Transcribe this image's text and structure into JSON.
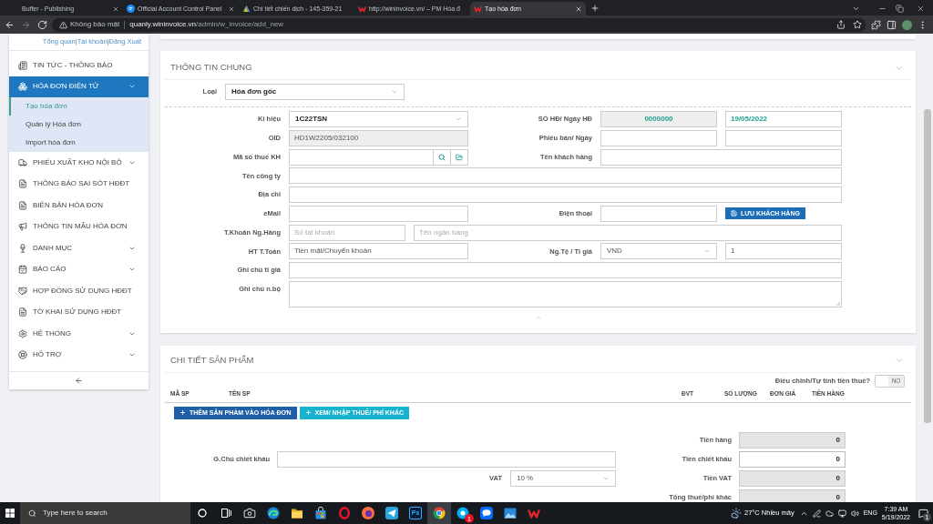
{
  "browser": {
    "tabs": [
      {
        "title": "Buffer - Publishing",
        "selected": false,
        "close_button": true
      },
      {
        "title": "Official Account Control Panel",
        "selected": false,
        "close_button": true
      },
      {
        "title": "Chi tiết chiến dịch - 145-359-21",
        "selected": false,
        "close_button": false
      },
      {
        "title": "http://wininvoice.vn/ – PM Hóa đ",
        "selected": false,
        "close_button": false
      },
      {
        "title": "Tạo hóa đơn",
        "selected": true,
        "close_button": true
      }
    ],
    "address_bar": {
      "security_label": "Không bảo mật",
      "host": "quanly.wininvoice.vn",
      "path": "/admin/w_invoice/add_new"
    }
  },
  "sidebar": {
    "account_links": [
      {
        "kind": "link",
        "text": "Tổng quan"
      },
      {
        "kind": "separator",
        "text": "|"
      },
      {
        "kind": "link",
        "text": "Tài khoản"
      },
      {
        "kind": "separator",
        "text": "|"
      },
      {
        "kind": "link",
        "text": "Đăng Xuất"
      }
    ],
    "items": [
      {
        "label": "TIN TỨC - THÔNG BÁO",
        "selected": false,
        "submenu": false
      },
      {
        "label": "HÓA ĐƠN ĐIỆN TỬ",
        "selected": true,
        "submenu": true,
        "children": [
          {
            "label": "Tạo hóa đơn",
            "selected": true
          },
          {
            "label": "Quản lý Hóa đơn",
            "selected": false
          },
          {
            "label": "Import hóa đơn",
            "selected": false
          }
        ]
      },
      {
        "label": "PHIẾU XUẤT KHO NỘI BỘ",
        "selected": false,
        "submenu": true
      },
      {
        "label": "THÔNG BÁO SAI SÓT HĐĐT",
        "selected": false,
        "submenu": false
      },
      {
        "label": "BIÊN BẢN HÓA ĐƠN",
        "selected": false,
        "submenu": false
      },
      {
        "label": "THÔNG TIN MẪU HÓA ĐƠN",
        "selected": false,
        "submenu": false
      },
      {
        "label": "DANH MỤC",
        "selected": false,
        "submenu": true
      },
      {
        "label": "BÁO CÁO",
        "selected": false,
        "submenu": true
      },
      {
        "label": "HỢP ĐỒNG SỬ DỤNG HĐĐT",
        "selected": false,
        "submenu": false
      },
      {
        "label": "TỜ KHAI SỬ DỤNG HĐĐT",
        "selected": false,
        "submenu": false
      },
      {
        "label": "HỆ THỐNG",
        "selected": false,
        "submenu": true
      },
      {
        "label": "HỖ TRỢ",
        "selected": false,
        "submenu": true
      }
    ]
  },
  "general_info": {
    "title": "THÔNG TIN CHUNG",
    "invoice_type": {
      "label": "Loại",
      "value": "Hóa đơn gốc",
      "bold": true
    },
    "rows": [
      {
        "label": "Kí hiệu",
        "left": [
          {
            "kind": "select",
            "value": "1C22TSN",
            "bold": true
          }
        ],
        "right_label": "SỐ HĐ/ Ngày HĐ",
        "right": [
          {
            "kind": "readonly",
            "value": "0000000",
            "highlighted": true
          },
          {
            "kind": "input",
            "value": "19/05/2022",
            "highlighted": true
          }
        ]
      },
      {
        "label": "OID",
        "left": [
          {
            "kind": "readonly",
            "value": "HD1W2205/032100",
            "highlighted": false
          }
        ],
        "right_label": "Phiếu bán/ Ngày",
        "right": [
          {
            "kind": "input"
          },
          {
            "kind": "input"
          }
        ]
      },
      {
        "label": "Mã số thuế KH",
        "left": [
          {
            "kind": "lookup"
          }
        ],
        "right_label": "Tên khách hàng",
        "right": [
          {
            "kind": "input"
          }
        ]
      },
      {
        "label": "Tên công ty",
        "left": [
          {
            "kind": "input"
          }
        ]
      },
      {
        "label": "Địa chỉ",
        "left": [
          {
            "kind": "input"
          }
        ]
      },
      {
        "label": "eMail",
        "left": [
          {
            "kind": "input"
          }
        ],
        "right_label": "Điện thoại",
        "right": [
          {
            "kind": "input"
          },
          {
            "kind": "button",
            "label": "LƯU KHÁCH HÀNG"
          }
        ]
      },
      {
        "label": "T.Khoản Ng.Hàng",
        "left": [
          {
            "kind": "input",
            "placeholder": "Số tài khoản"
          },
          {
            "kind": "input",
            "placeholder": "Tên ngân hàng"
          }
        ]
      },
      {
        "label": "HT T.Toán",
        "left": [
          {
            "kind": "input",
            "value": "Tiền mặt/Chuyển khoản",
            "highlighted": false
          }
        ],
        "right_label": "Ng.Tệ / Tỉ giá",
        "right": [
          {
            "kind": "select",
            "value": "VND",
            "bold": false
          },
          {
            "kind": "input",
            "value": "1",
            "highlighted": false
          }
        ]
      },
      {
        "label": "Ghi chú tỉ giá",
        "left": [
          {
            "kind": "input"
          }
        ]
      },
      {
        "label": "Ghi chú n.bộ",
        "left": [
          {
            "kind": "textarea"
          }
        ]
      }
    ]
  },
  "product_details": {
    "title": "CHI TIẾT SẢN PHẨM",
    "tax_toggle": {
      "label": "Điều chỉnh/Tự tính tiền thuế?",
      "on": false,
      "state_text": "NO"
    },
    "columns": [
      "MÃ SP",
      "TÊN SP",
      "ĐVT",
      "SỐ LƯỢNG",
      "ĐƠN GIÁ",
      "TIỀN HÀNG"
    ],
    "buttons": [
      {
        "kind": "primary",
        "label": "THÊM SẢN PHẨM VÀO HÓA ĐƠN"
      },
      {
        "kind": "info",
        "label": "XEM/ NHẬP THUẾ/ PHÍ KHÁC"
      }
    ],
    "discount_note": {
      "label": "G.Chú chiết khấu"
    },
    "vat": {
      "label": "VAT",
      "value": "10 %",
      "bold": false
    },
    "totals": [
      {
        "label": "Tiền hàng",
        "value": "0",
        "editable": false
      },
      {
        "label": "Tiền chiết khấu",
        "value": "0",
        "editable": true
      },
      {
        "label": "Tiền VAT",
        "value": "0",
        "editable": false
      },
      {
        "label": "Tổng thuế/phí khác",
        "value": "0",
        "editable": false
      }
    ]
  },
  "taskbar": {
    "search_placeholder": "Type here to search",
    "apps": [
      {
        "selected": false
      },
      {
        "selected": false
      },
      {
        "selected": false
      },
      {
        "selected": false
      },
      {
        "selected": false
      },
      {
        "selected": false
      },
      {
        "selected": false
      },
      {
        "selected": false,
        "label": "Ps"
      },
      {
        "selected": true
      },
      {
        "selected": false,
        "badge": "1"
      },
      {
        "selected": false
      },
      {
        "selected": false
      },
      {
        "selected": false
      }
    ],
    "weather": "27°C Nhiều mây",
    "language": "ENG",
    "time": "7:39 AM",
    "date": "5/19/2022",
    "notifications": "1"
  }
}
